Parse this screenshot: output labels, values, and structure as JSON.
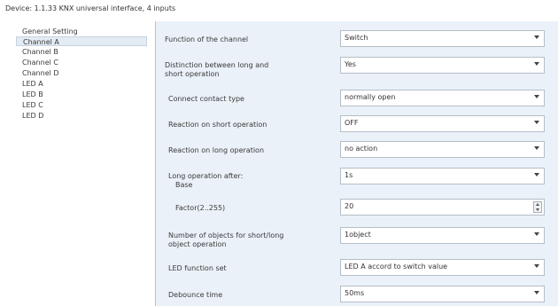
{
  "window": {
    "title": "Device: 1.1.33  KNX universal interface, 4 inputs"
  },
  "sidebar": {
    "items": [
      {
        "label": "General Setting",
        "selected": false
      },
      {
        "label": "Channel A",
        "selected": true
      },
      {
        "label": "Channel B",
        "selected": false
      },
      {
        "label": "Channel C",
        "selected": false
      },
      {
        "label": "Channel D",
        "selected": false
      },
      {
        "label": "LED A",
        "selected": false
      },
      {
        "label": "LED B",
        "selected": false
      },
      {
        "label": "LED C",
        "selected": false
      },
      {
        "label": "LED D",
        "selected": false
      }
    ]
  },
  "params": {
    "function": {
      "label": "Function of the channel",
      "value": "Switch"
    },
    "distinction": {
      "label": "Distinction between long and",
      "label2": "short operation",
      "value": "Yes"
    },
    "contact": {
      "label": "Connect contact type",
      "value": "normally open"
    },
    "short_op": {
      "label": "Reaction on short operation",
      "value": "OFF"
    },
    "long_op": {
      "label": "Reaction on long operation",
      "value": "no action"
    },
    "long_after": {
      "label": "Long operation after:",
      "label2": "Base",
      "value": "1s"
    },
    "factor": {
      "label": "Factor(2..255)",
      "value": "20"
    },
    "objects": {
      "label": "Number of objects for short/long",
      "label2": "object operation",
      "value": "1object"
    },
    "led_func": {
      "label": "LED function set",
      "value": "LED A accord to switch value"
    },
    "debounce": {
      "label": "Debounce time",
      "value": "50ms"
    }
  },
  "colors": {
    "panel_bg": "#eaf1f8",
    "selected_bg": "#e3ebf3"
  }
}
